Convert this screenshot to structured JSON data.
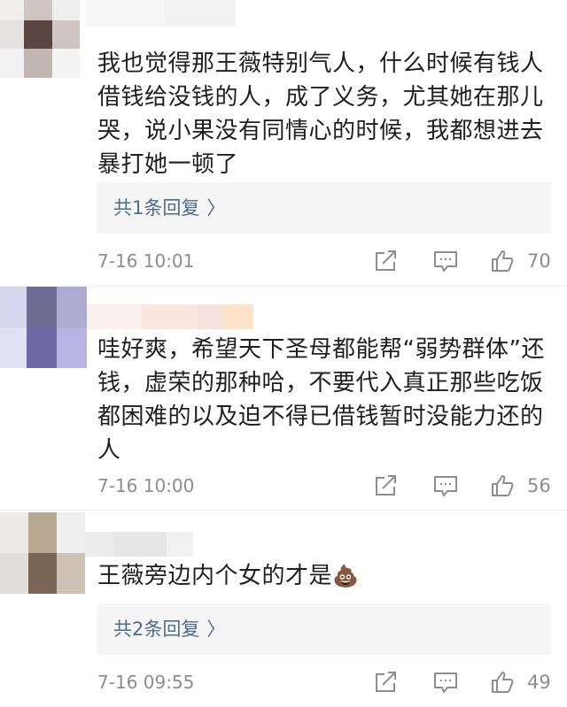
{
  "comments": [
    {
      "text": "我也觉得那王薇特别气人，什么时候有钱人借钱给没钱的人，成了义务，尤其她在那儿哭，说小果没有同情心的时候，我都想进去暴打她一顿了",
      "replies": "共1条回复",
      "time": "7-16 10:01",
      "likes": "70"
    },
    {
      "text": "哇好爽，希望天下圣母都能帮“弱势群体”还钱，虚荣的那种哈，不要代入真正那些吃饭都困难的以及迫不得已借钱暂时没能力还的人",
      "time": "7-16 10:00",
      "likes": "56"
    },
    {
      "text": "王薇旁边内个女的才是",
      "emoji": "💩",
      "replies": "共2条回复",
      "time": "7-16 09:55",
      "likes": "49"
    }
  ],
  "icons": {
    "reply_chevron": "chevron-right-icon",
    "share": "share-edit-icon",
    "comment": "comment-icon",
    "like": "thumbs-up-icon"
  },
  "colors": {
    "link": "#4e6d8d",
    "meta": "#8d8d8d",
    "reply_bg": "#f5f5f5"
  }
}
